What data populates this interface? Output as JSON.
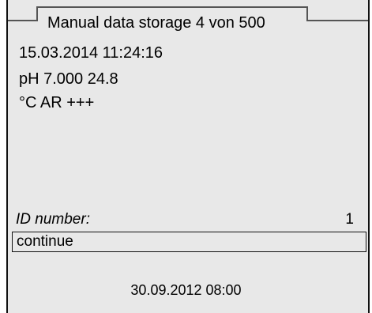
{
  "title": "Manual data storage 4 von 500",
  "record": {
    "datetime": "15.03.2014  11:24:16",
    "measurement": "pH 7.000   24.8",
    "unit_status": "°C  AR  +++"
  },
  "id_field": {
    "label": "ID number:",
    "value": "1"
  },
  "action": {
    "continue_label": "continue"
  },
  "footer": {
    "datetime": "30.09.2012 08:00"
  },
  "colors": {
    "background": "#e8e8e8",
    "frame": "#111111"
  }
}
